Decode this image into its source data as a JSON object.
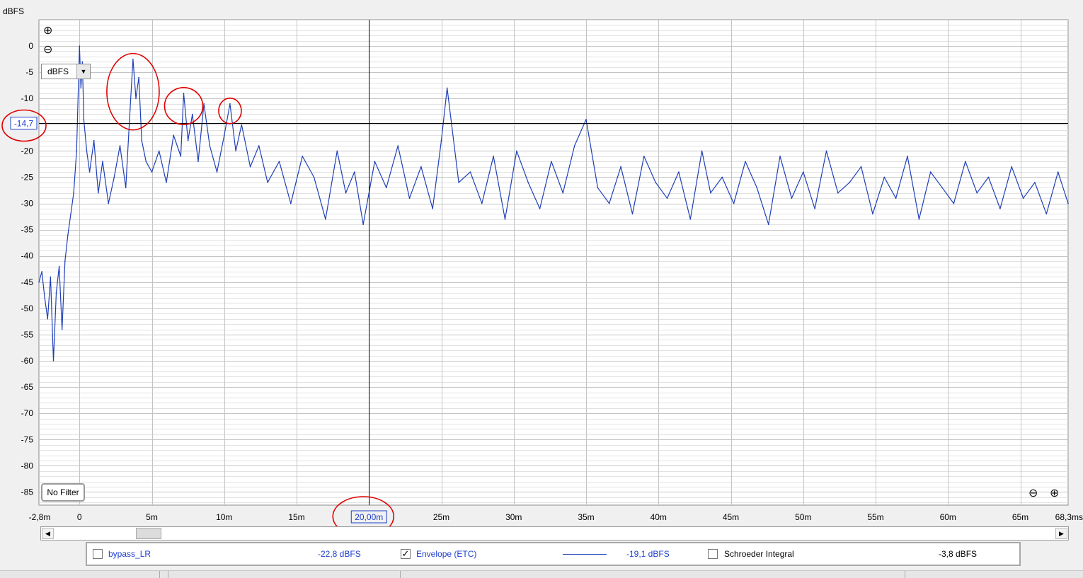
{
  "chart_data": {
    "type": "line",
    "ylabel": "dBFS",
    "xlim": [
      -2.8,
      68.3
    ],
    "ylim": [
      -87.5,
      5
    ],
    "y_ticks": [
      "0",
      "-5",
      "-10",
      "-15",
      "-20",
      "-25",
      "-30",
      "-35",
      "-40",
      "-45",
      "-50",
      "-55",
      "-60",
      "-65",
      "-70",
      "-75",
      "-80",
      "-85"
    ],
    "x_tick_values": [
      -2.8,
      0,
      5,
      10,
      15,
      20,
      25,
      30,
      35,
      40,
      45,
      50,
      55,
      60,
      65,
      68.3
    ],
    "x_tick_labels": [
      "-2,8m",
      "0",
      "5m",
      "10m",
      "15m",
      "20,00m",
      "25m",
      "30m",
      "35m",
      "40m",
      "45m",
      "50m",
      "55m",
      "60m",
      "65m",
      "68,3ms"
    ],
    "grid": true,
    "cursor": {
      "x": 20.0,
      "y": -14.7,
      "x_label": "20,00m",
      "y_label": "-14,7"
    },
    "annotations": [
      {
        "type": "circle",
        "around": "cursor-y-readout"
      },
      {
        "type": "circle",
        "around": "peak",
        "x": 3.7,
        "y": -2.5
      },
      {
        "type": "circle",
        "around": "peak",
        "x": 7.2,
        "y": -9
      },
      {
        "type": "circle",
        "around": "peak",
        "x": 10.4,
        "y": -11
      },
      {
        "type": "circle",
        "around": "cursor-x-readout"
      }
    ],
    "series": [
      {
        "name": "Envelope (ETC)",
        "color": "#1f3fb8",
        "x": [
          -2.8,
          -2.6,
          -2.4,
          -2.2,
          -2.0,
          -1.8,
          -1.6,
          -1.4,
          -1.2,
          -1.0,
          -0.8,
          -0.6,
          -0.4,
          -0.2,
          0.0,
          0.1,
          0.2,
          0.3,
          0.5,
          0.7,
          1.0,
          1.3,
          1.6,
          2.0,
          2.4,
          2.8,
          3.2,
          3.5,
          3.7,
          3.9,
          4.1,
          4.3,
          4.6,
          5.0,
          5.5,
          6.0,
          6.5,
          7.0,
          7.2,
          7.5,
          7.8,
          8.2,
          8.6,
          9.0,
          9.5,
          10.0,
          10.4,
          10.8,
          11.2,
          11.8,
          12.4,
          13.0,
          13.8,
          14.6,
          15.4,
          16.2,
          17.0,
          17.8,
          18.4,
          19.0,
          19.6,
          20.4,
          21.2,
          22.0,
          22.8,
          23.6,
          24.4,
          25.0,
          25.4,
          26.2,
          27.0,
          27.8,
          28.6,
          29.4,
          30.2,
          31.0,
          31.8,
          32.6,
          33.4,
          34.2,
          35.0,
          35.8,
          36.6,
          37.4,
          38.2,
          39.0,
          39.8,
          40.6,
          41.4,
          42.2,
          43.0,
          43.6,
          44.4,
          45.2,
          46.0,
          46.8,
          47.6,
          48.4,
          49.2,
          50.0,
          50.8,
          51.6,
          52.4,
          53.2,
          54.0,
          54.8,
          55.6,
          56.4,
          57.2,
          58.0,
          58.8,
          59.6,
          60.4,
          61.2,
          62.0,
          62.8,
          63.6,
          64.4,
          65.2,
          66.0,
          66.8,
          67.6,
          68.3
        ],
        "y": [
          -45,
          -43,
          -48,
          -52,
          -44,
          -60,
          -47,
          -42,
          -54,
          -41,
          -36,
          -32,
          -28,
          -20,
          0,
          -8,
          -3,
          -14,
          -20,
          -24,
          -18,
          -28,
          -22,
          -30,
          -25,
          -19,
          -27,
          -12,
          -2.5,
          -10,
          -6,
          -18,
          -22,
          -24,
          -20,
          -26,
          -17,
          -21,
          -9,
          -18,
          -13,
          -22,
          -11,
          -19,
          -24,
          -17,
          -11,
          -20,
          -15,
          -23,
          -19,
          -26,
          -22,
          -30,
          -21,
          -25,
          -33,
          -20,
          -28,
          -24,
          -34,
          -22,
          -27,
          -19,
          -29,
          -23,
          -31,
          -18,
          -8,
          -26,
          -24,
          -30,
          -21,
          -33,
          -20,
          -26,
          -31,
          -22,
          -28,
          -19,
          -14,
          -27,
          -30,
          -23,
          -32,
          -21,
          -26,
          -29,
          -24,
          -33,
          -20,
          -28,
          -25,
          -30,
          -22,
          -27,
          -34,
          -21,
          -29,
          -24,
          -31,
          -20,
          -28,
          -26,
          -23,
          -32,
          -25,
          -29,
          -21,
          -33,
          -24,
          -27,
          -30,
          -22,
          -28,
          -25,
          -31,
          -23,
          -29,
          -26,
          -32,
          -24,
          -30
        ]
      }
    ]
  },
  "controls": {
    "unit_label": "dBFS",
    "unit_dropdown": "dBFS",
    "filter_button": "No Filter",
    "zoom_in": "⊕",
    "zoom_out": "⊖",
    "scroll_left": "◀",
    "scroll_right": "▶"
  },
  "legend": {
    "item1": {
      "label": "bypass_LR",
      "value": "-22,8 dBFS",
      "checked": false
    },
    "item2": {
      "label": "Envelope (ETC)",
      "value": "-19,1 dBFS",
      "checked": true,
      "check_mark": "✓"
    },
    "item3": {
      "label": "Schroeder Integral",
      "value": "-3,8 dBFS",
      "checked": false
    }
  }
}
